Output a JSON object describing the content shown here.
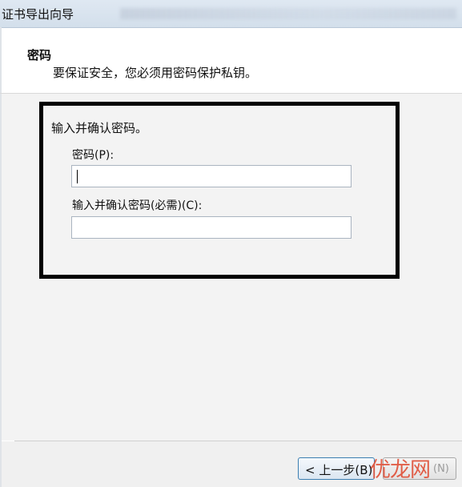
{
  "window": {
    "title": "证书导出向导"
  },
  "header": {
    "section_title": "密码",
    "section_description": "要保证安全，您必须用密码保护私钥。"
  },
  "form": {
    "group_label": "输入并确认密码。",
    "password_label": "密码(P):",
    "password_value": "",
    "confirm_label": "输入并确认密码(必需)(C):",
    "confirm_value": ""
  },
  "footer": {
    "back_label": "< 上一步(B)",
    "next_label": "(N)"
  },
  "watermark": {
    "text": "优龙网"
  },
  "colors": {
    "title_bar": "#d6e2ee",
    "content_background": "#f3f3f3",
    "highlight_border": "#000000",
    "watermark": "#e0523a"
  }
}
